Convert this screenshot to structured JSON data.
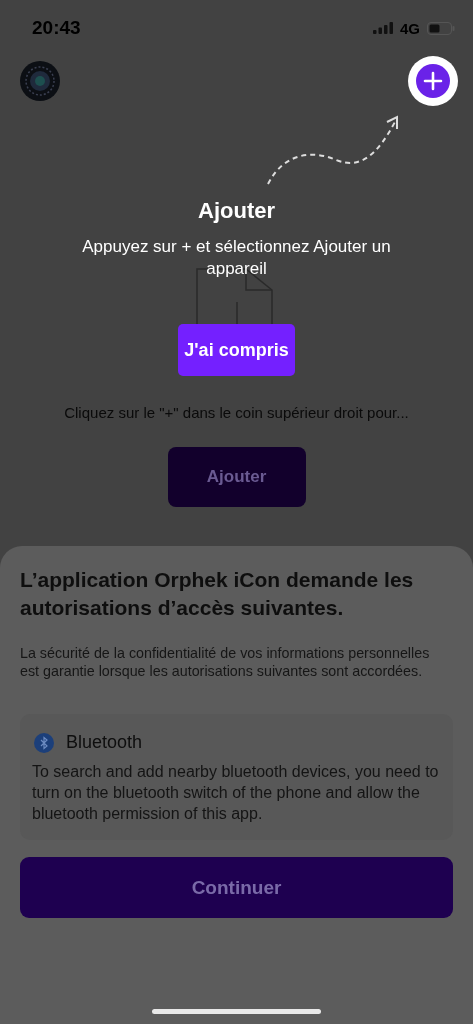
{
  "status_bar": {
    "time": "20:43",
    "network": "4G"
  },
  "coach_mark": {
    "title": "Ajouter",
    "message": "Appuyez sur + et sélectionnez Ajouter un appareil",
    "button": "J'ai compris"
  },
  "empty_state": {
    "hint": "Cliquez sur le \"+\" dans le coin supérieur droit pour...",
    "button": "Ajouter"
  },
  "permission_sheet": {
    "title": "L’application Orphek iCon demande les autorisations d’accès suivantes.",
    "description": "La sécurité de la confidentialité de vos informations personnelles est garantie lorsque les autorisations suivantes sont accordées.",
    "permissions": [
      {
        "kind": "bluetooth",
        "name": "Bluetooth",
        "description": "To search and add nearby bluetooth devices, you need to turn on the bluetooth switch of the phone and allow the bluetooth permission of this app."
      }
    ],
    "button": "Continuer"
  }
}
